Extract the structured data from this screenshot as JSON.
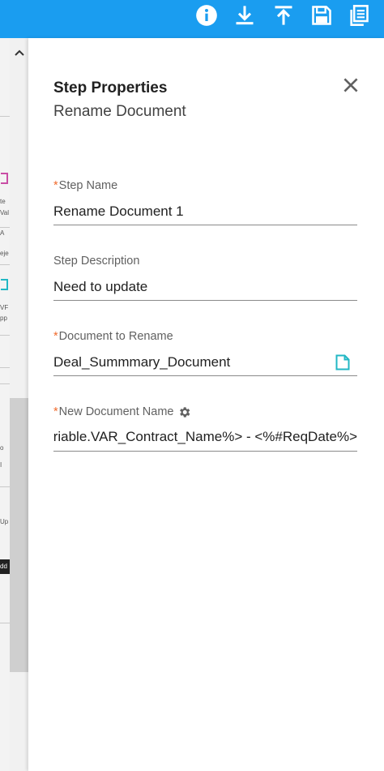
{
  "colors": {
    "topbar": "#1a9df0",
    "required_star": "#f06a2c",
    "doc_icon": "#22b7c4"
  },
  "toolbar": {
    "icons": [
      "info-icon",
      "download-icon",
      "upload-icon",
      "save-icon",
      "copy-icon"
    ]
  },
  "background_fragments": [
    "te",
    "Val",
    "A",
    "eje",
    "VF",
    "pp",
    "o",
    "I",
    "Up",
    "dd"
  ],
  "panel": {
    "title": "Step Properties",
    "subtitle": "Rename Document",
    "fields": {
      "step_name": {
        "label": "Step Name",
        "required": "*",
        "value": "Rename Document 1"
      },
      "step_description": {
        "label": "Step Description",
        "value": "Need to update"
      },
      "document_to_rename": {
        "label": "Document to Rename",
        "required": "*",
        "value": "Deal_Summmary_Document"
      },
      "new_document_name": {
        "label": "New Document Name",
        "required": "*",
        "value": "/ariable.VAR_Contract_Name%> - <%#ReqDate%>"
      }
    }
  }
}
